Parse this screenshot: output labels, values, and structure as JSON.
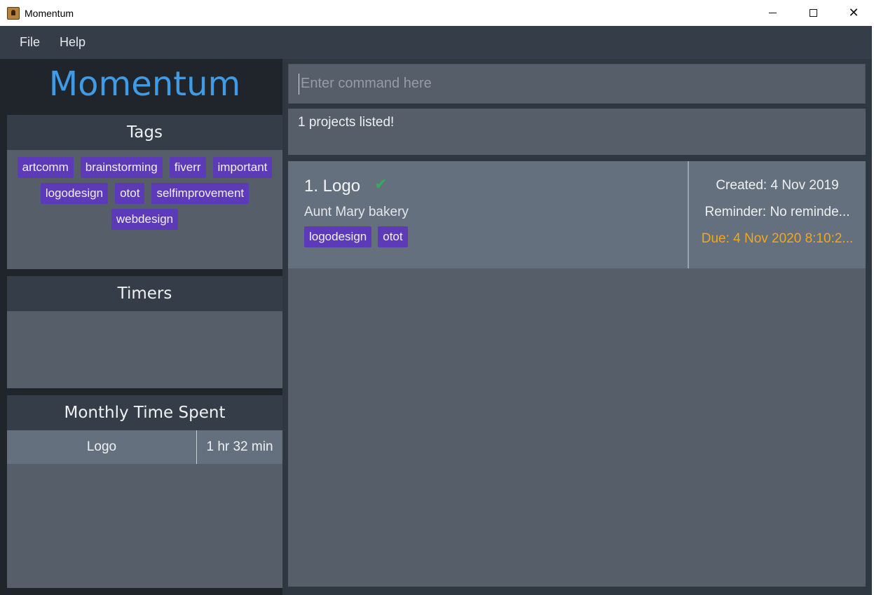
{
  "window": {
    "title": "Momentum",
    "controls": {
      "minimize": "─",
      "maximize": "☐",
      "close": "✕"
    }
  },
  "menu": {
    "items": [
      "File",
      "Help"
    ]
  },
  "brand": "Momentum",
  "tags_panel": {
    "title": "Tags",
    "tags": [
      "artcomm",
      "brainstorming",
      "fiverr",
      "important",
      "logodesign",
      "otot",
      "selfimprovement",
      "webdesign"
    ]
  },
  "timers_panel": {
    "title": "Timers"
  },
  "monthly_panel": {
    "title": "Monthly Time Spent",
    "rows": [
      {
        "name": "Logo",
        "time": "1 hr 32 min"
      }
    ]
  },
  "command": {
    "placeholder": "Enter command here",
    "value": ""
  },
  "result": {
    "text": "1 projects listed!"
  },
  "projects": [
    {
      "title": "1. Logo",
      "completed_icon": "check-icon",
      "description": "Aunt Mary bakery",
      "tags": [
        "logodesign",
        "otot"
      ],
      "created": "Created: 4 Nov 2019",
      "reminder": "Reminder: No reminde...",
      "due": "Due: 4 Nov 2020 8:10:2..."
    }
  ],
  "colors": {
    "brand": "#3f9be5",
    "tag": "#5d3ab8",
    "due": "#f0a81c",
    "check": "#2fae55"
  }
}
